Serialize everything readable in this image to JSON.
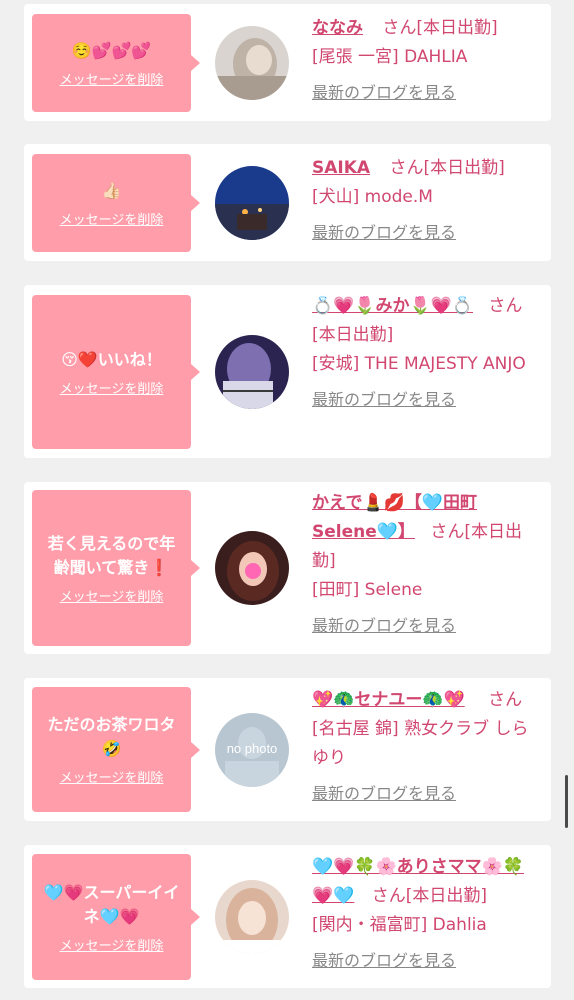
{
  "delete_label": "メッセージを削除",
  "blog_label": "最新のブログを見る",
  "suffix_label": "さん",
  "status_label": "[本日出勤]",
  "items": [
    {
      "message": "☺️💕💕💕",
      "name": "ななみ",
      "suffix": "さん",
      "status": "[本日出勤]",
      "shop": "[尾張 一宮] DAHLIA",
      "avatar_icon": "photo-avatar"
    },
    {
      "message": "👍🏻",
      "name": "SAIKA",
      "suffix": "さん",
      "status": "[本日出勤]",
      "shop": "[犬山] mode.M",
      "avatar_icon": "photo-avatar"
    },
    {
      "message": "😚❤️いいね！",
      "name": "💍💗🌷みか🌷💗💍",
      "suffix": "さん",
      "status": "[本日出勤]",
      "shop": "[安城] THE MAJESTY ANJO",
      "avatar_icon": "photo-avatar"
    },
    {
      "message": "若く見えるので年齢聞いて驚き❗️",
      "name": "かえで💄💋【🩵田町Selene🩵】",
      "suffix": "さん",
      "status": "[本日出勤]",
      "shop": "[田町] Selene",
      "avatar_icon": "photo-avatar"
    },
    {
      "message": "ただのお茶ワロタ🤣",
      "name": "💖🦚セナユー🦚💖",
      "suffix": "さん",
      "status": "",
      "shop": "[名古屋 錦] 熟女クラブ しらゆり",
      "avatar_text": "no photo",
      "avatar_icon": "no-photo-avatar"
    },
    {
      "message": "🩵💗スーパーイイネ🩵💗",
      "name": "🩵💗🍀🌸ありさママ🌸🍀💗🩵",
      "suffix": "さん",
      "status": "[本日出勤]",
      "shop": "[関内・福富町] Dahlia",
      "avatar_icon": "photo-avatar"
    }
  ]
}
